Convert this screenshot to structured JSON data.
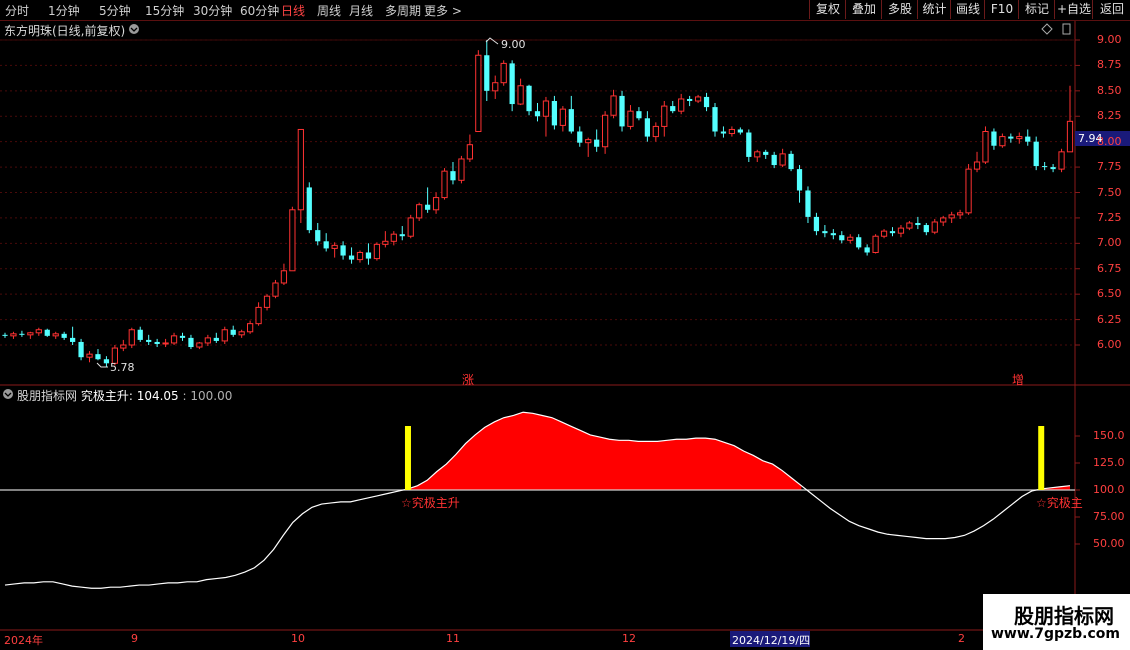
{
  "toolbar": {
    "periods": [
      "分时",
      "1分钟",
      "5分钟",
      "15分钟",
      "30分钟",
      "60分钟",
      "日线",
      "周线",
      "月线",
      "多周期",
      "更多 >"
    ],
    "active_period": "日线",
    "tools": [
      "复权",
      "叠加",
      "多股",
      "统计",
      "画线",
      "F10",
      "标记",
      "+自选",
      "返回"
    ]
  },
  "main_header": {
    "title": "东方明珠(日线,前复权)",
    "price_label": "7.94"
  },
  "indicator_header": {
    "name": "股朋指标网",
    "line_label": "究极主升: 104.05",
    "ref_value": ": 100.00"
  },
  "annotations": {
    "high_label": "9.00",
    "low_label": "5.78",
    "mark_zhang": "涨",
    "mark_zeng": "增",
    "signal_label_1": "☆究极主升",
    "signal_label_2": "☆究极主"
  },
  "price_axis": [
    "9.00",
    "8.75",
    "8.50",
    "8.25",
    "8.00",
    "7.75",
    "7.50",
    "7.25",
    "7.00",
    "6.75",
    "6.50",
    "6.25",
    "6.00"
  ],
  "indicator_axis": [
    "150.0",
    "125.0",
    "100.0",
    "75.00",
    "50.00"
  ],
  "dates": [
    "2024年",
    "9",
    "10",
    "11",
    "12",
    "2024/12/19/四",
    "2"
  ],
  "watermark": {
    "title": "股朋指标网",
    "url": "www.7gpzb.com"
  },
  "colors": {
    "up": "#ff3232",
    "down": "#54ffff",
    "fill": "#ff0000",
    "signal_bar": "#ffff00"
  },
  "chart_data": {
    "type": "candlestick",
    "y_range": [
      5.7,
      9.05
    ],
    "candles": [
      [
        6.1,
        6.12,
        6.07,
        6.09
      ],
      [
        6.09,
        6.13,
        6.06,
        6.11
      ],
      [
        6.11,
        6.14,
        6.08,
        6.1
      ],
      [
        6.1,
        6.13,
        6.06,
        6.12
      ],
      [
        6.12,
        6.17,
        6.09,
        6.15
      ],
      [
        6.15,
        6.16,
        6.08,
        6.09
      ],
      [
        6.09,
        6.13,
        6.06,
        6.11
      ],
      [
        6.11,
        6.13,
        6.05,
        6.07
      ],
      [
        6.07,
        6.18,
        6.0,
        6.03
      ],
      [
        6.03,
        6.06,
        5.85,
        5.88
      ],
      [
        5.88,
        5.94,
        5.83,
        5.91
      ],
      [
        5.91,
        5.96,
        5.85,
        5.86
      ],
      [
        5.86,
        5.89,
        5.78,
        5.82
      ],
      [
        5.82,
        6.0,
        5.8,
        5.97
      ],
      [
        5.97,
        6.05,
        5.94,
        6.0
      ],
      [
        6.0,
        6.17,
        5.97,
        6.15
      ],
      [
        6.15,
        6.18,
        6.03,
        6.05
      ],
      [
        6.05,
        6.1,
        6.0,
        6.03
      ],
      [
        6.03,
        6.06,
        5.98,
        6.01
      ],
      [
        6.01,
        6.06,
        5.98,
        6.02
      ],
      [
        6.02,
        6.12,
        6.0,
        6.09
      ],
      [
        6.09,
        6.12,
        6.04,
        6.07
      ],
      [
        6.07,
        6.1,
        5.96,
        5.98
      ],
      [
        5.98,
        6.03,
        5.96,
        6.02
      ],
      [
        6.02,
        6.1,
        5.99,
        6.07
      ],
      [
        6.07,
        6.12,
        6.02,
        6.04
      ],
      [
        6.04,
        6.18,
        6.01,
        6.15
      ],
      [
        6.15,
        6.19,
        6.08,
        6.1
      ],
      [
        6.1,
        6.15,
        6.07,
        6.13
      ],
      [
        6.13,
        6.24,
        6.11,
        6.21
      ],
      [
        6.21,
        6.42,
        6.19,
        6.37
      ],
      [
        6.37,
        6.5,
        6.34,
        6.48
      ],
      [
        6.48,
        6.64,
        6.46,
        6.61
      ],
      [
        6.61,
        6.8,
        6.59,
        6.73
      ],
      [
        6.73,
        7.36,
        6.96,
        7.33
      ],
      [
        7.33,
        7.8,
        7.2,
        8.12
      ],
      [
        7.55,
        7.6,
        7.1,
        7.13
      ],
      [
        7.13,
        7.2,
        6.98,
        7.02
      ],
      [
        7.02,
        7.1,
        6.92,
        6.95
      ],
      [
        6.95,
        7.01,
        6.86,
        6.98
      ],
      [
        6.98,
        7.02,
        6.84,
        6.88
      ],
      [
        6.88,
        6.96,
        6.8,
        6.84
      ],
      [
        6.84,
        6.93,
        6.81,
        6.91
      ],
      [
        6.91,
        7.0,
        6.79,
        6.85
      ],
      [
        6.85,
        7.01,
        6.83,
        6.99
      ],
      [
        6.99,
        7.12,
        6.96,
        7.02
      ],
      [
        7.02,
        7.12,
        6.98,
        7.09
      ],
      [
        7.09,
        7.17,
        7.03,
        7.07
      ],
      [
        7.07,
        7.28,
        7.05,
        7.25
      ],
      [
        7.25,
        7.4,
        7.22,
        7.38
      ],
      [
        7.38,
        7.55,
        7.3,
        7.33
      ],
      [
        7.33,
        7.5,
        7.29,
        7.45
      ],
      [
        7.45,
        7.74,
        7.43,
        7.71
      ],
      [
        7.71,
        7.8,
        7.58,
        7.62
      ],
      [
        7.62,
        7.86,
        7.59,
        7.83
      ],
      [
        7.83,
        8.07,
        7.8,
        7.97
      ],
      [
        8.1,
        8.9,
        8.1,
        8.85
      ],
      [
        8.85,
        9.0,
        8.4,
        8.5
      ],
      [
        8.5,
        8.65,
        8.42,
        8.58
      ],
      [
        8.58,
        8.8,
        8.55,
        8.77
      ],
      [
        8.77,
        8.8,
        8.3,
        8.37
      ],
      [
        8.37,
        8.62,
        8.36,
        8.55
      ],
      [
        8.55,
        8.56,
        8.26,
        8.3
      ],
      [
        8.3,
        8.38,
        8.2,
        8.25
      ],
      [
        8.25,
        8.44,
        8.05,
        8.4
      ],
      [
        8.4,
        8.45,
        8.12,
        8.16
      ],
      [
        8.16,
        8.35,
        8.1,
        8.32
      ],
      [
        8.32,
        8.45,
        8.08,
        8.1
      ],
      [
        8.1,
        8.15,
        7.95,
        7.99
      ],
      [
        7.99,
        8.04,
        7.85,
        8.02
      ],
      [
        8.02,
        8.12,
        7.9,
        7.95
      ],
      [
        7.95,
        8.3,
        7.88,
        8.26
      ],
      [
        8.26,
        8.51,
        8.23,
        8.45
      ],
      [
        8.45,
        8.5,
        8.1,
        8.15
      ],
      [
        8.15,
        8.36,
        8.12,
        8.3
      ],
      [
        8.3,
        8.34,
        8.21,
        8.23
      ],
      [
        8.23,
        8.3,
        8.0,
        8.05
      ],
      [
        8.05,
        8.19,
        8.0,
        8.15
      ],
      [
        8.15,
        8.4,
        8.05,
        8.35
      ],
      [
        8.35,
        8.4,
        8.28,
        8.3
      ],
      [
        8.3,
        8.47,
        8.27,
        8.42
      ],
      [
        8.42,
        8.45,
        8.35,
        8.4
      ],
      [
        8.4,
        8.46,
        8.38,
        8.44
      ],
      [
        8.44,
        8.48,
        8.3,
        8.34
      ],
      [
        8.34,
        8.38,
        8.05,
        8.1
      ],
      [
        8.1,
        8.15,
        8.04,
        8.08
      ],
      [
        8.08,
        8.15,
        8.05,
        8.12
      ],
      [
        8.12,
        8.14,
        8.07,
        8.09
      ],
      [
        8.09,
        8.12,
        7.8,
        7.85
      ],
      [
        7.85,
        7.92,
        7.8,
        7.9
      ],
      [
        7.9,
        7.92,
        7.83,
        7.87
      ],
      [
        7.87,
        7.9,
        7.74,
        7.77
      ],
      [
        7.77,
        7.93,
        7.75,
        7.88
      ],
      [
        7.88,
        7.91,
        7.71,
        7.73
      ],
      [
        7.73,
        7.77,
        7.4,
        7.52
      ],
      [
        7.52,
        7.56,
        7.2,
        7.26
      ],
      [
        7.26,
        7.3,
        7.08,
        7.12
      ],
      [
        7.12,
        7.18,
        7.06,
        7.1
      ],
      [
        7.1,
        7.14,
        7.04,
        7.08
      ],
      [
        7.08,
        7.12,
        7.0,
        7.03
      ],
      [
        7.03,
        7.09,
        7.0,
        7.06
      ],
      [
        7.06,
        7.09,
        6.94,
        6.96
      ],
      [
        6.96,
        6.99,
        6.88,
        6.91
      ],
      [
        6.91,
        7.09,
        6.9,
        7.07
      ],
      [
        7.07,
        7.14,
        7.05,
        7.12
      ],
      [
        7.12,
        7.16,
        7.07,
        7.1
      ],
      [
        7.1,
        7.18,
        7.06,
        7.15
      ],
      [
        7.15,
        7.22,
        7.13,
        7.2
      ],
      [
        7.2,
        7.26,
        7.14,
        7.18
      ],
      [
        7.18,
        7.2,
        7.08,
        7.11
      ],
      [
        7.11,
        7.24,
        7.09,
        7.21
      ],
      [
        7.21,
        7.27,
        7.17,
        7.25
      ],
      [
        7.25,
        7.31,
        7.2,
        7.28
      ],
      [
        7.28,
        7.33,
        7.24,
        7.3
      ],
      [
        7.3,
        7.78,
        7.28,
        7.73
      ],
      [
        7.73,
        7.9,
        7.7,
        7.8
      ],
      [
        7.8,
        8.15,
        7.78,
        8.1
      ],
      [
        8.1,
        8.13,
        7.92,
        7.96
      ],
      [
        7.96,
        8.08,
        7.94,
        8.05
      ],
      [
        8.05,
        8.08,
        7.99,
        8.03
      ],
      [
        8.03,
        8.09,
        7.98,
        8.05
      ],
      [
        8.05,
        8.12,
        7.96,
        8.0
      ],
      [
        8.0,
        8.05,
        7.72,
        7.76
      ],
      [
        7.76,
        7.8,
        7.72,
        7.75
      ],
      [
        7.75,
        7.78,
        7.7,
        7.73
      ],
      [
        7.73,
        7.93,
        7.7,
        7.9
      ],
      [
        7.9,
        8.55,
        7.9,
        8.2
      ]
    ],
    "indicator_series": {
      "name": "究极主升",
      "y_range": [
        0,
        198
      ],
      "values": [
        12,
        13,
        14,
        14,
        15,
        15,
        13,
        11,
        10,
        9,
        9,
        10,
        10,
        11,
        12,
        12,
        13,
        14,
        14,
        15,
        15,
        17,
        18,
        19,
        21,
        24,
        28,
        35,
        45,
        58,
        70,
        78,
        84,
        87,
        88,
        89,
        89,
        91,
        93,
        95,
        97,
        99,
        101,
        104,
        109,
        117,
        124,
        133,
        143,
        151,
        158,
        163,
        167,
        169,
        172,
        171,
        169,
        167,
        163,
        159,
        155,
        151,
        149,
        147,
        146,
        146,
        145,
        145,
        145,
        146,
        147,
        147,
        148,
        148,
        147,
        144,
        141,
        136,
        132,
        127,
        124,
        118,
        111,
        104,
        97,
        90,
        83,
        77,
        71,
        67,
        64,
        61,
        59,
        58,
        57,
        56,
        55,
        55,
        55,
        56,
        58,
        62,
        67,
        73,
        80,
        87,
        94,
        99,
        101,
        102,
        103,
        104
      ]
    },
    "reference_line": 100,
    "signals": [
      "究极主升",
      "究极主升"
    ]
  }
}
